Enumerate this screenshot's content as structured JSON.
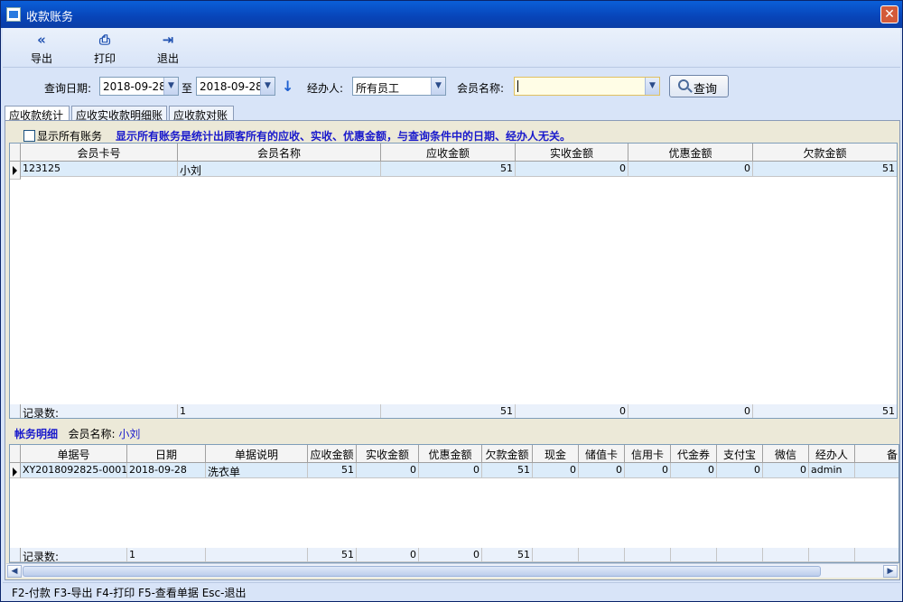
{
  "window": {
    "title": "收款账务",
    "close_icon": "close-icon"
  },
  "toolbar": {
    "export_label": "导出",
    "print_label": "打印",
    "exit_label": "退出"
  },
  "query": {
    "date_label": "查询日期:",
    "date_from": "2018-09-28",
    "to_label": "至",
    "date_to": "2018-09-28",
    "handler_label": "经办人:",
    "handler_value": "所有员工",
    "member_label": "会员名称:",
    "member_value": "",
    "search_label": "查询"
  },
  "tabs": [
    {
      "label": "应收款统计"
    },
    {
      "label": "应收实收款明细账"
    },
    {
      "label": "应收款对账"
    }
  ],
  "summary": {
    "show_all_label": "显示所有账务",
    "hint": "显示所有账务是统计出顾客所有的应收、实收、优惠金额，与查询条件中的日期、经办人无关。",
    "columns": [
      "会员卡号",
      "会员名称",
      "应收金额",
      "实收金额",
      "优惠金额",
      "欠款金额"
    ],
    "rows": [
      [
        "123125",
        "小刘",
        "51",
        "0",
        "0",
        "51"
      ]
    ],
    "footer": [
      "记录数:",
      "1",
      "51",
      "0",
      "0",
      "51"
    ]
  },
  "detail": {
    "title": "帐务明细",
    "member_label": "会员名称:",
    "member_name": "小刘",
    "columns": [
      "单据号",
      "日期",
      "单据说明",
      "应收金额",
      "实收金额",
      "优惠金额",
      "欠款金额",
      "现金",
      "储值卡",
      "信用卡",
      "代金券",
      "支付宝",
      "微信",
      "经办人",
      "备"
    ],
    "rows": [
      [
        "XY2018092825-0001",
        "2018-09-28",
        "洗衣单",
        "51",
        "0",
        "0",
        "51",
        "0",
        "0",
        "0",
        "0",
        "0",
        "0",
        "admin",
        ""
      ]
    ],
    "footer": [
      "记录数:",
      "1",
      "",
      "51",
      "0",
      "0",
      "51",
      "",
      "",
      "",
      "",
      "",
      "",
      "",
      ""
    ]
  },
  "statusbar": {
    "text": "F2-付款 F3-导出 F4-打印 F5-查看单据 Esc-退出"
  }
}
